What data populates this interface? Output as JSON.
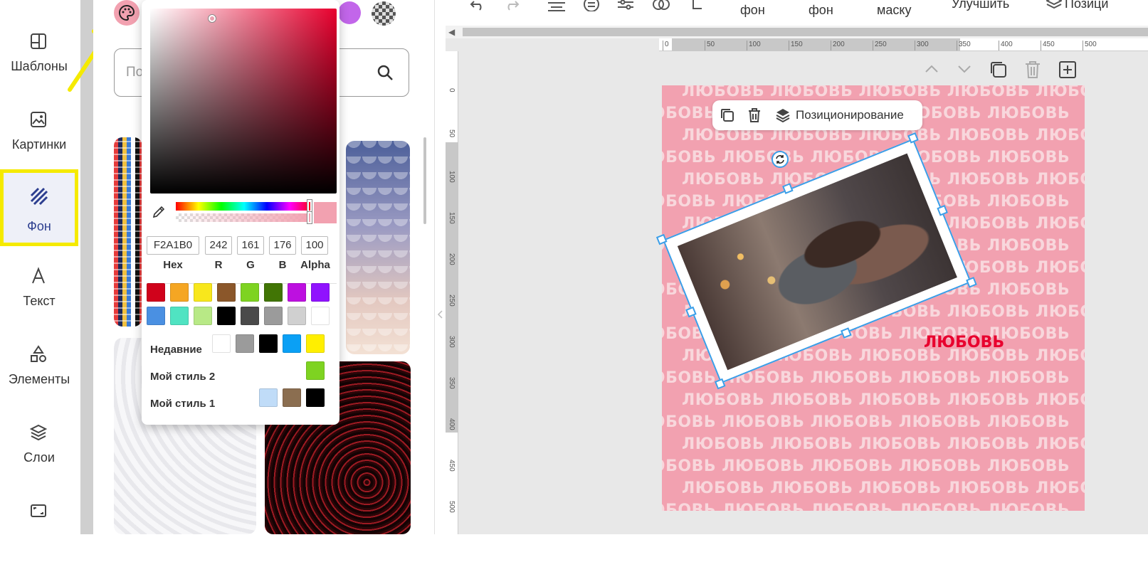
{
  "sidebar": {
    "items": [
      {
        "label": "Шаблоны",
        "icon": "template-icon"
      },
      {
        "label": "Картинки",
        "icon": "image-icon"
      },
      {
        "label": "Фон",
        "icon": "background-icon",
        "active": true
      },
      {
        "label": "Текст",
        "icon": "text-icon"
      },
      {
        "label": "Элементы",
        "icon": "elements-icon"
      },
      {
        "label": "Слои",
        "icon": "layers-icon"
      }
    ]
  },
  "panel": {
    "search_placeholder": "По"
  },
  "picker": {
    "hex": "F2A1B0",
    "r": "242",
    "g": "161",
    "b": "176",
    "alpha": "100",
    "labels": {
      "hex": "Hex",
      "r": "R",
      "g": "G",
      "b": "B",
      "alpha": "Alpha"
    },
    "presets_row1": [
      "#d0021b",
      "#f5a623",
      "#f8e71c",
      "#8b572a",
      "#7ed321",
      "#417505",
      "#bd10e0",
      "#9013fe"
    ],
    "presets_row2": [
      "#4a90e2",
      "#50e3c2",
      "#b8e986",
      "#000000",
      "#4a4a4a",
      "#9b9b9b",
      "#d0d0d0",
      "#ffffff"
    ],
    "recent_label": "Недавние",
    "recent": [
      "#ffffff",
      "#9b9b9b",
      "#000000",
      "#0aa0f5",
      "#ffef00"
    ],
    "style2_label": "Мой стиль 2",
    "style2": [
      "#7ed321"
    ],
    "style1_label": "Мой стиль 1",
    "style1": [
      "#c0dcf8",
      "#8b6e50",
      "#000000"
    ]
  },
  "topbar": {
    "btn_bg1": "фон",
    "btn_bg2": "фон",
    "btn_mask": "маску",
    "btn_improve": "Улучшить",
    "btn_position": "Позици"
  },
  "ruler": {
    "top": [
      "0",
      "50",
      "100",
      "150",
      "200",
      "250",
      "300",
      "350",
      "400",
      "450",
      "500"
    ],
    "left": [
      "0",
      "50",
      "100",
      "150",
      "200",
      "250",
      "300",
      "350",
      "400",
      "450",
      "500"
    ]
  },
  "canvas": {
    "bg_color": "#f2a1b0",
    "pattern_word": "ЛЮБОВЬ ЛЮБОВЬ ЛЮБОВЬ ЛЮБОВЬ ЛЮБОВЬ",
    "highlight_word": "ЛЮБОВЬ",
    "float_toolbar_label": "Позиционирование"
  },
  "colors": {
    "accent": "#3a9ee8",
    "highlight": "#f5ea00",
    "active_text": "#2c3e8f"
  }
}
